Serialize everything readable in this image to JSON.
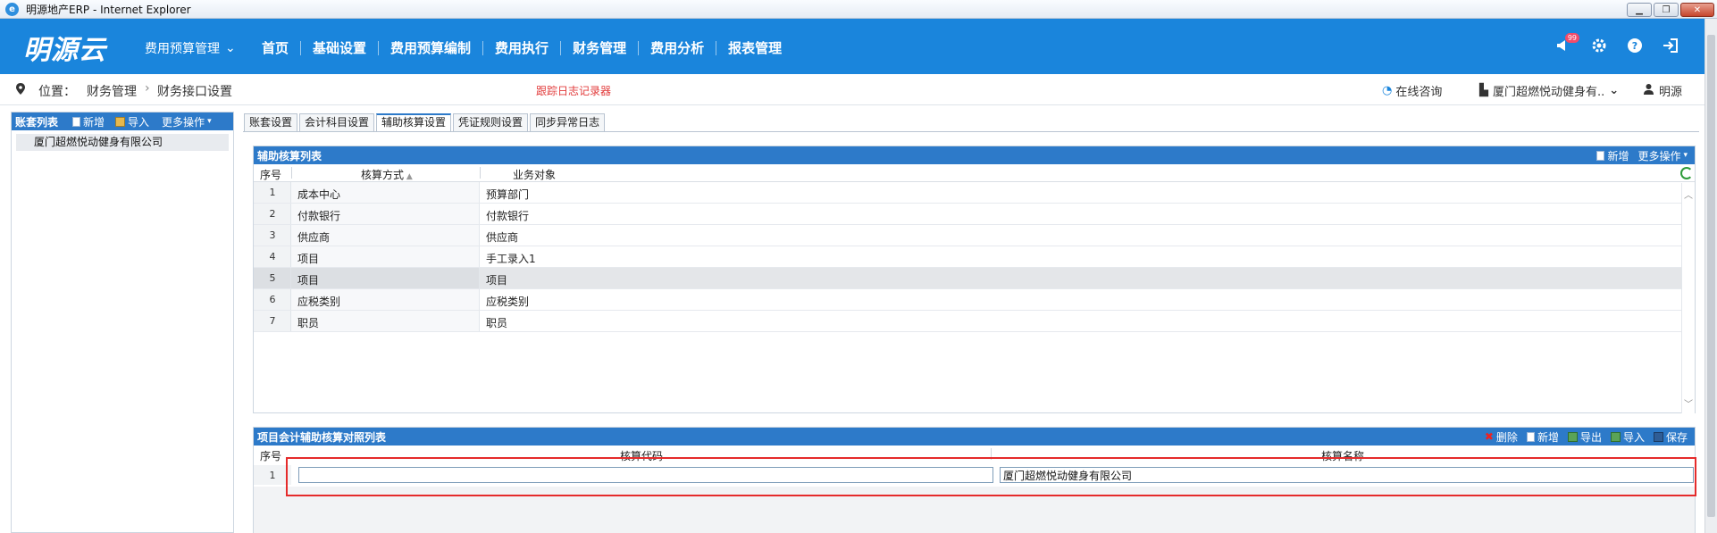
{
  "window": {
    "title": "明源地产ERP - Internet Explorer"
  },
  "header": {
    "brand": "明源云",
    "module_selector": "费用预算管理",
    "nav": [
      "首页",
      "基础设置",
      "费用预算编制",
      "费用执行",
      "财务管理",
      "费用分析",
      "报表管理"
    ],
    "notification_count": "99",
    "accent_color": "#1a85dc"
  },
  "breadcrumb": {
    "label": "位置：",
    "items": [
      "财务管理",
      "财务接口设置"
    ],
    "trace_link": "跟踪日志记录器",
    "online": "在线咨询",
    "org": "厦门超燃悦动健身有..",
    "user": "明源"
  },
  "left_panel": {
    "title": "账套列表",
    "add": "新增",
    "import": "导入",
    "more": "更多操作",
    "items": [
      "厦门超燃悦动健身有限公司"
    ]
  },
  "tabs": [
    "账套设置",
    "会计科目设置",
    "辅助核算设置",
    "凭证规则设置",
    "同步异常日志"
  ],
  "grid1": {
    "title": "辅助核算列表",
    "add": "新增",
    "more": "更多操作",
    "columns": [
      "序号",
      "核算方式",
      "业务对象"
    ],
    "rows": [
      {
        "no": "1",
        "method": "成本中心",
        "object": "预算部门"
      },
      {
        "no": "2",
        "method": "付款银行",
        "object": "付款银行"
      },
      {
        "no": "3",
        "method": "供应商",
        "object": "供应商"
      },
      {
        "no": "4",
        "method": "项目",
        "object": "手工录入1"
      },
      {
        "no": "5",
        "method": "项目",
        "object": "项目"
      },
      {
        "no": "6",
        "method": "应税类别",
        "object": "应税类别"
      },
      {
        "no": "7",
        "method": "职员",
        "object": "职员"
      }
    ],
    "selected_row": 5
  },
  "grid2": {
    "title": "项目会计辅助核算对照列表",
    "ops": [
      "删除",
      "新增",
      "导出",
      "导入",
      "保存"
    ],
    "columns": [
      "序号",
      "核算代码",
      "核算名称"
    ],
    "rows": [
      {
        "no": "1",
        "code": "",
        "name": "厦门超燃悦动健身有限公司"
      }
    ]
  }
}
